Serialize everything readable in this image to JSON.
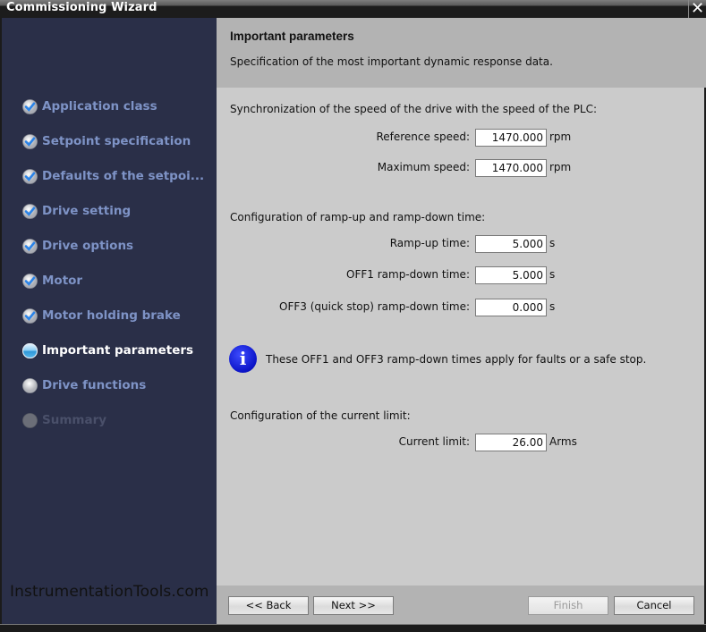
{
  "window": {
    "title": "Commissioning Wizard",
    "close_icon": "close-icon"
  },
  "sidebar": {
    "steps": [
      {
        "label": "Application class",
        "state": "done",
        "icon": "check-circle-icon"
      },
      {
        "label": "Setpoint specification",
        "state": "done",
        "icon": "check-circle-icon"
      },
      {
        "label": "Defaults of the setpoi...",
        "state": "done",
        "icon": "check-circle-icon"
      },
      {
        "label": "Drive setting",
        "state": "done",
        "icon": "check-circle-icon"
      },
      {
        "label": "Drive options",
        "state": "done",
        "icon": "check-circle-icon"
      },
      {
        "label": "Motor",
        "state": "done",
        "icon": "check-circle-icon"
      },
      {
        "label": "Motor holding brake",
        "state": "done",
        "icon": "check-circle-icon"
      },
      {
        "label": "Important parameters",
        "state": "current",
        "icon": "current-step-icon"
      },
      {
        "label": "Drive functions",
        "state": "pending",
        "icon": "pending-step-icon"
      },
      {
        "label": "Summary",
        "state": "disabled",
        "icon": "disabled-step-icon"
      }
    ],
    "watermark": "InstrumentationTools.com"
  },
  "header": {
    "title": "Important parameters",
    "subtitle": "Specification of the most important dynamic response data."
  },
  "content": {
    "speed_section": {
      "label": "Synchronization of the speed of the drive with the speed of the PLC:",
      "fields": [
        {
          "label": "Reference speed:",
          "value": "1470.000",
          "unit": "rpm"
        },
        {
          "label": "Maximum speed:",
          "value": "1470.000",
          "unit": "rpm"
        }
      ]
    },
    "ramp_section": {
      "label": "Configuration of ramp-up and ramp-down time:",
      "fields": [
        {
          "label": "Ramp-up time:",
          "value": "5.000",
          "unit": "s"
        },
        {
          "label": "OFF1 ramp-down time:",
          "value": "5.000",
          "unit": "s"
        },
        {
          "label": "OFF3 (quick stop) ramp-down time:",
          "value": "0.000",
          "unit": "s"
        }
      ]
    },
    "info": {
      "icon": "info-icon",
      "glyph": "i",
      "text": "These OFF1 and OFF3 ramp-down times apply for faults or a safe stop."
    },
    "current_section": {
      "label": "Configuration of the current limit:",
      "fields": [
        {
          "label": "Current limit:",
          "value": "26.00",
          "unit": "Arms"
        }
      ]
    }
  },
  "footer": {
    "back_label": "<< Back",
    "next_label": "Next >>",
    "finish_label": "Finish",
    "cancel_label": "Cancel"
  },
  "colors": {
    "sidebar_bg": "#2a2f48",
    "step_done_text": "#7e93c6",
    "step_current_text": "#ffffff",
    "header_bg": "#b3b3b3",
    "content_bg": "#cbcbcb",
    "info_icon": "#0b14c7"
  }
}
